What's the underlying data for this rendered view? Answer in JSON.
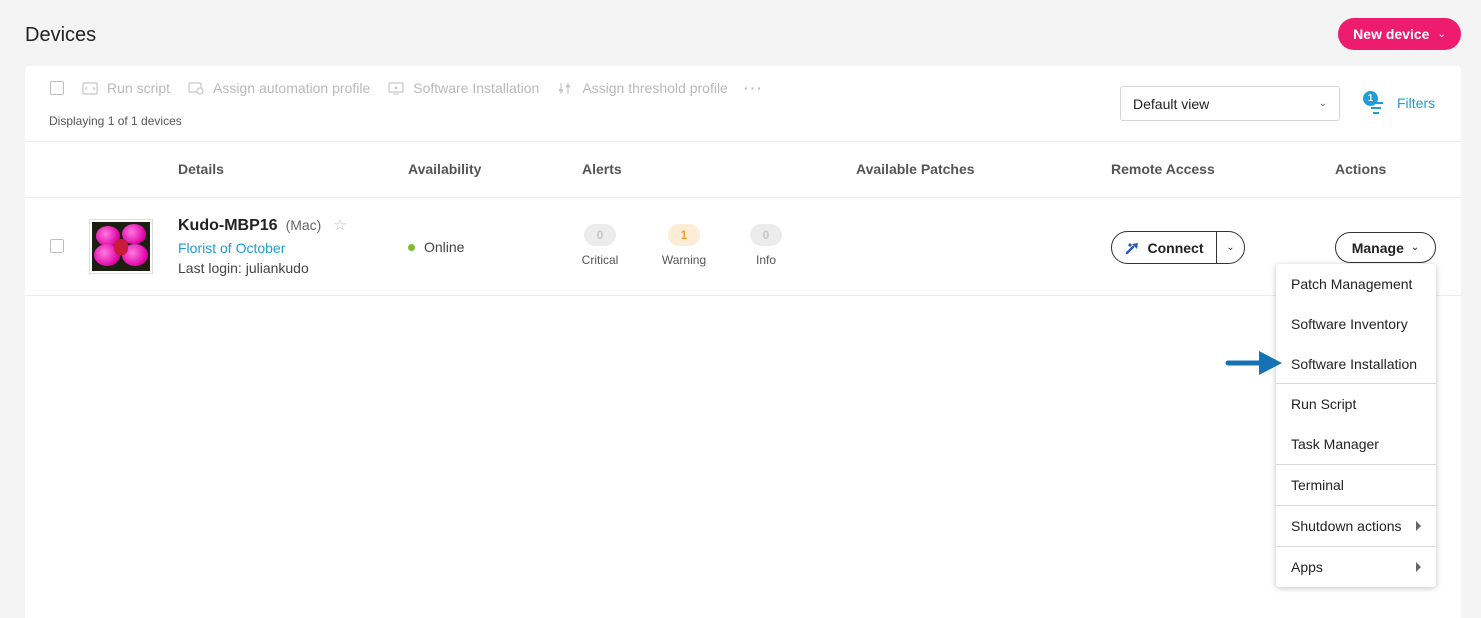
{
  "page": {
    "title": "Devices",
    "new_device_label": "New device"
  },
  "toolbar": {
    "actions": [
      {
        "label": "Run script",
        "icon": "script-icon"
      },
      {
        "label": "Assign automation profile",
        "icon": "automation-icon"
      },
      {
        "label": "Software Installation",
        "icon": "monitor-icon"
      },
      {
        "label": "Assign threshold profile",
        "icon": "sliders-icon"
      }
    ],
    "more_label": "···",
    "count_text": "Displaying 1 of 1 devices",
    "view_select": {
      "value": "Default view"
    },
    "filters": {
      "label": "Filters",
      "count": "1"
    }
  },
  "table": {
    "columns": [
      "Details",
      "Availability",
      "Alerts",
      "Available Patches",
      "Remote Access",
      "Actions"
    ],
    "rows": [
      {
        "name": "Kudo-MBP16",
        "os": "(Mac)",
        "organization": "Florist of October",
        "last_login": "Last login: juliankudo",
        "availability": "Online",
        "alerts": [
          {
            "count": "0",
            "label": "Critical"
          },
          {
            "count": "1",
            "label": "Warning"
          },
          {
            "count": "0",
            "label": "Info"
          }
        ],
        "connect_label": "Connect",
        "manage_label": "Manage"
      }
    ]
  },
  "manage_menu": {
    "items": [
      "Patch Management",
      "Software Inventory",
      "Software Installation",
      "Run Script",
      "Task Manager",
      "Terminal",
      "Shutdown actions",
      "Apps"
    ]
  },
  "colors": {
    "accent": "#ed1c6f",
    "link": "#1d9ed9",
    "online": "#7cbd35",
    "arrow": "#1573b5"
  }
}
